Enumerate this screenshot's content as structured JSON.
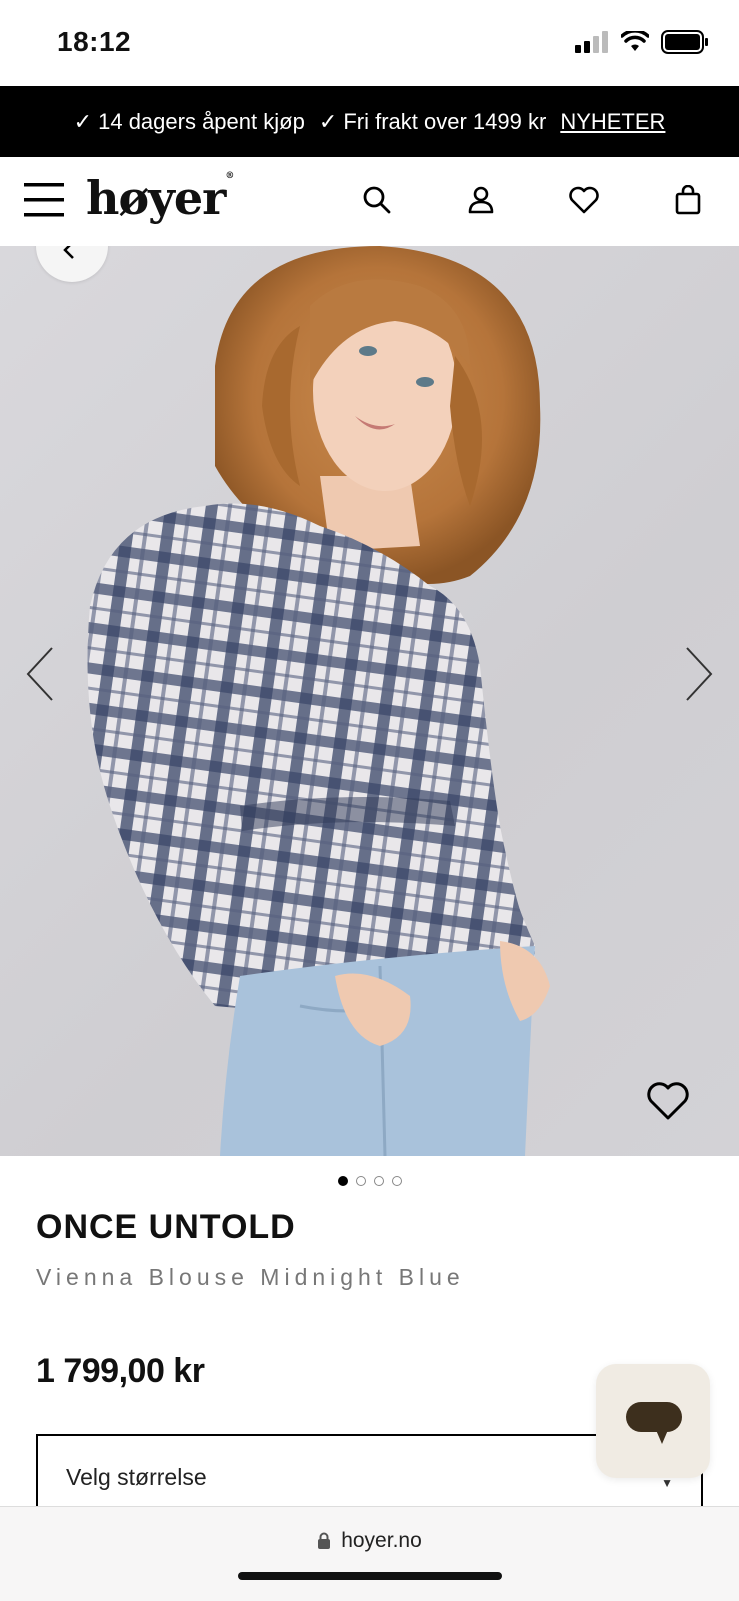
{
  "status_bar": {
    "time": "18:12"
  },
  "promo": {
    "item1": "✓ 14 dagers åpent kjøp",
    "item2": "✓ Fri frakt over 1499 kr",
    "link": "NYHETER"
  },
  "header": {
    "logo": "høyer",
    "icons": [
      "menu-icon",
      "search-icon",
      "account-icon",
      "heart-icon",
      "bag-icon"
    ]
  },
  "gallery": {
    "image_count": 4,
    "active_index": 1
  },
  "product": {
    "brand": "ONCE UNTOLD",
    "name": "Vienna Blouse Midnight Blue",
    "price": "1 799,00 kr"
  },
  "size_select": {
    "placeholder": "Velg størrelse"
  },
  "browser": {
    "url": "hoyer.no"
  },
  "colors": {
    "promo_bg": "#000000",
    "chat_bg": "#f0ebe3",
    "shirt_navy": "#3b4668"
  }
}
